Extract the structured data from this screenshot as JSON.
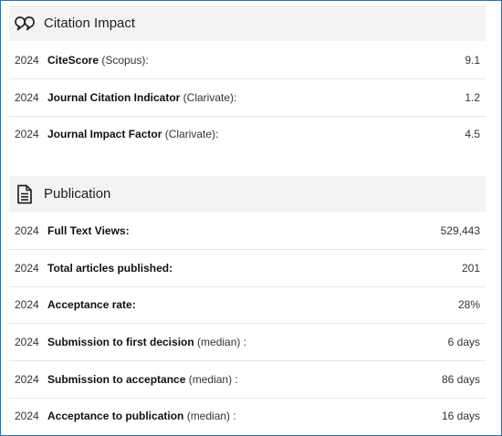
{
  "citation": {
    "title": "Citation Impact",
    "icon": "quote-bubble-icon",
    "rows": [
      {
        "year": "2024",
        "label": "CiteScore",
        "qualifier": " (Scopus):",
        "value": "9.1"
      },
      {
        "year": "2024",
        "label": "Journal Citation Indicator",
        "qualifier": " (Clarivate):",
        "value": "1.2"
      },
      {
        "year": "2024",
        "label": "Journal Impact Factor",
        "qualifier": " (Clarivate):",
        "value": "4.5"
      }
    ]
  },
  "publication": {
    "title": "Publication",
    "icon": "document-icon",
    "rows": [
      {
        "year": "2024",
        "label": "Full Text Views:",
        "qualifier": "",
        "value": "529,443"
      },
      {
        "year": "2024",
        "label": "Total articles published:",
        "qualifier": "",
        "value": "201"
      },
      {
        "year": "2024",
        "label": "Acceptance rate:",
        "qualifier": "",
        "value": "28%"
      },
      {
        "year": "2024",
        "label": "Submission to first decision",
        "qualifier": " (median) :",
        "value": "6 days"
      },
      {
        "year": "2024",
        "label": "Submission to acceptance",
        "qualifier": " (median) :",
        "value": "86 days"
      },
      {
        "year": "2024",
        "label": "Acceptance to publication",
        "qualifier": " (median) :",
        "value": "16 days"
      }
    ]
  }
}
